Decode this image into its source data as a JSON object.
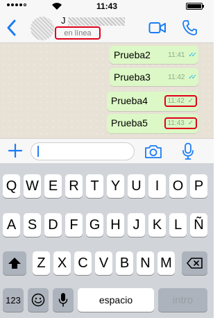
{
  "status_bar": {
    "time": "11:43"
  },
  "header": {
    "back_icon": "chevron-left-icon",
    "contact_name_visible": "J",
    "presence": "en línea",
    "video_icon": "video-camera-icon",
    "call_icon": "phone-icon"
  },
  "messages": [
    {
      "text": "Prueba2",
      "time": "11:41",
      "status": "read",
      "tick": "✓✓"
    },
    {
      "text": "Prueba3",
      "time": "11:42",
      "status": "read",
      "tick": "✓✓"
    },
    {
      "text": "Prueba4",
      "time": "11:42",
      "status": "sent",
      "tick": "✓"
    },
    {
      "text": "Prueba5",
      "time": "11:43",
      "status": "sent",
      "tick": "✓"
    }
  ],
  "composer": {
    "value": "",
    "plus_icon": "plus-icon",
    "camera_icon": "camera-icon",
    "mic_icon": "microphone-icon"
  },
  "keyboard": {
    "row1": [
      "Q",
      "W",
      "E",
      "R",
      "T",
      "Y",
      "U",
      "I",
      "O",
      "P"
    ],
    "row2": [
      "A",
      "S",
      "D",
      "F",
      "G",
      "H",
      "J",
      "K",
      "L",
      "Ñ"
    ],
    "row3": [
      "Z",
      "X",
      "C",
      "V",
      "B",
      "N",
      "M"
    ],
    "bottom": {
      "numbers": "123",
      "space": "espacio",
      "return": "intro"
    },
    "shift_icon": "shift-arrow-icon",
    "delete_icon": "backspace-icon",
    "emoji_icon": "emoji-icon",
    "dictation_icon": "microphone-icon"
  },
  "colors": {
    "accent": "#1a7cf5",
    "bubble_outgoing": "#dcf8c6",
    "chat_background": "#e7e1d6",
    "read_tick": "#34b7f1",
    "highlight_red": "#e0001a"
  }
}
